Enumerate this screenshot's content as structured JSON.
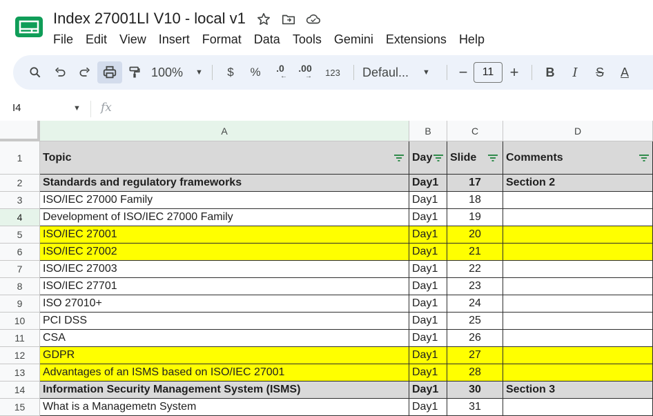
{
  "app": {
    "title": "Index 27001LI V10 - local v1",
    "icons": [
      "star-icon",
      "move-to-folder-icon",
      "cloud-saved-icon"
    ]
  },
  "menu": [
    "File",
    "Edit",
    "View",
    "Insert",
    "Format",
    "Data",
    "Tools",
    "Gemini",
    "Extensions",
    "Help"
  ],
  "toolbar": {
    "zoom": "100%",
    "currency": "$",
    "percent": "%",
    "decrease_decimal": ".0",
    "increase_decimal": ".00",
    "number_format": "123",
    "font": "Defaul...",
    "font_size": "11",
    "minus": "−",
    "plus": "+",
    "bold": "B",
    "italic": "I",
    "strike": "S",
    "text_color": "A"
  },
  "formula_bar": {
    "name_box": "I4",
    "fx": "fx"
  },
  "columns": [
    "A",
    "B",
    "C",
    "D"
  ],
  "header": {
    "topic": "Topic",
    "day": "Day",
    "slide": "Slide",
    "comments": "Comments"
  },
  "rows": [
    {
      "num": "1"
    },
    {
      "num": "2",
      "topic": "Standards and regulatory frameworks",
      "day": "Day1",
      "slide": "17",
      "comments": "Section 2",
      "style": "section"
    },
    {
      "num": "3",
      "topic": "ISO/IEC 27000 Family",
      "day": "Day1",
      "slide": "18",
      "comments": "",
      "style": "normal"
    },
    {
      "num": "4",
      "topic": "Development of ISO/IEC 27000 Family",
      "day": "Day1",
      "slide": "19",
      "comments": "",
      "style": "normal"
    },
    {
      "num": "5",
      "topic": "ISO/IEC 27001",
      "day": "Day1",
      "slide": "20",
      "comments": "",
      "style": "highlight"
    },
    {
      "num": "6",
      "topic": "ISO/IEC 27002",
      "day": "Day1",
      "slide": "21",
      "comments": "",
      "style": "highlight"
    },
    {
      "num": "7",
      "topic": "ISO/IEC 27003",
      "day": "Day1",
      "slide": "22",
      "comments": "",
      "style": "normal"
    },
    {
      "num": "8",
      "topic": "ISO/IEC 27701",
      "day": "Day1",
      "slide": "23",
      "comments": "",
      "style": "normal"
    },
    {
      "num": "9",
      "topic": "ISO 27010+",
      "day": "Day1",
      "slide": "24",
      "comments": "",
      "style": "normal"
    },
    {
      "num": "10",
      "topic": "PCI DSS",
      "day": "Day1",
      "slide": "25",
      "comments": "",
      "style": "normal"
    },
    {
      "num": "11",
      "topic": "CSA",
      "day": "Day1",
      "slide": "26",
      "comments": "",
      "style": "normal"
    },
    {
      "num": "12",
      "topic": "GDPR",
      "day": "Day1",
      "slide": "27",
      "comments": "",
      "style": "highlight"
    },
    {
      "num": "13",
      "topic": "Advantages of an ISMS based on ISO/IEC 27001",
      "day": "Day1",
      "slide": "28",
      "comments": "",
      "style": "highlight"
    },
    {
      "num": "14",
      "topic": "Information Security Management System (ISMS)",
      "day": "Day1",
      "slide": "30",
      "comments": "Section 3",
      "style": "section"
    },
    {
      "num": "15",
      "topic": "What is a Managemetn System",
      "day": "Day1",
      "slide": "31",
      "comments": "",
      "style": "normal"
    }
  ],
  "colors": {
    "highlight": "#ffff00",
    "section_fill": "#d9d9d9",
    "toolbar_bg": "#edf2fa",
    "selected_header": "#e6f4ea",
    "logo_green": "#0f9d58"
  }
}
